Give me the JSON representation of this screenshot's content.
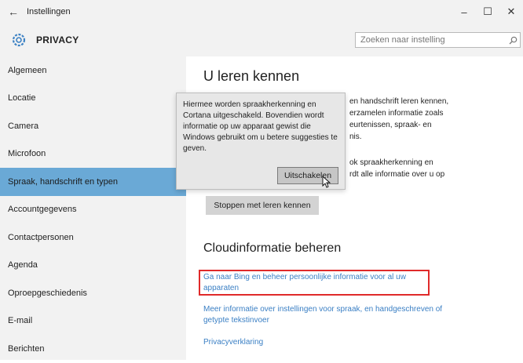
{
  "window": {
    "title": "Instellingen",
    "back_icon": "←",
    "minimize_icon": "–",
    "maximize_icon": "☐",
    "close_icon": "✕"
  },
  "header": {
    "section_title": "PRIVACY",
    "icon": "gear-icon",
    "search": {
      "placeholder": "Zoeken naar instelling",
      "icon": "search-icon"
    }
  },
  "sidebar": {
    "items": [
      {
        "label": "Algemeen",
        "selected": false
      },
      {
        "label": "Locatie",
        "selected": false
      },
      {
        "label": "Camera",
        "selected": false
      },
      {
        "label": "Microfoon",
        "selected": false
      },
      {
        "label": "Spraak, handschrift en typen",
        "selected": true
      },
      {
        "label": "Accountgegevens",
        "selected": false
      },
      {
        "label": "Contactpersonen",
        "selected": false
      },
      {
        "label": "Agenda",
        "selected": false
      },
      {
        "label": "Oproepgeschiedenis",
        "selected": false
      },
      {
        "label": "E-mail",
        "selected": false
      },
      {
        "label": "Berichten",
        "selected": false
      }
    ]
  },
  "main": {
    "heading": "U leren kennen",
    "para1_lines": [
      "en handschrift leren kennen,",
      "erzamelen informatie zoals",
      "eurtenissen, spraak- en",
      "nis."
    ],
    "para2_lines": [
      "ok spraakherkenning en",
      "rdt alle informatie over u op"
    ],
    "stop_button": "Stoppen met leren kennen",
    "cloud_heading": "Cloudinformatie beheren",
    "link_bing": "Ga naar Bing en beheer persoonlijke informatie voor al uw apparaten",
    "link_more": "Meer informatie over instellingen voor spraak, en handgeschreven of getypte tekstinvoer",
    "link_privacy": "Privacyverklaring"
  },
  "popup": {
    "text": "Hiermee worden spraakherkenning en Cortana uitgeschakeld. Bovendien wordt informatie op uw apparaat gewist die Windows gebruikt om u betere suggesties te geven.",
    "button": "Uitschakelen"
  },
  "colors": {
    "selected_nav": "#6aa9d6",
    "link": "#3a7fc4",
    "highlight_box": "#e02a2a"
  }
}
